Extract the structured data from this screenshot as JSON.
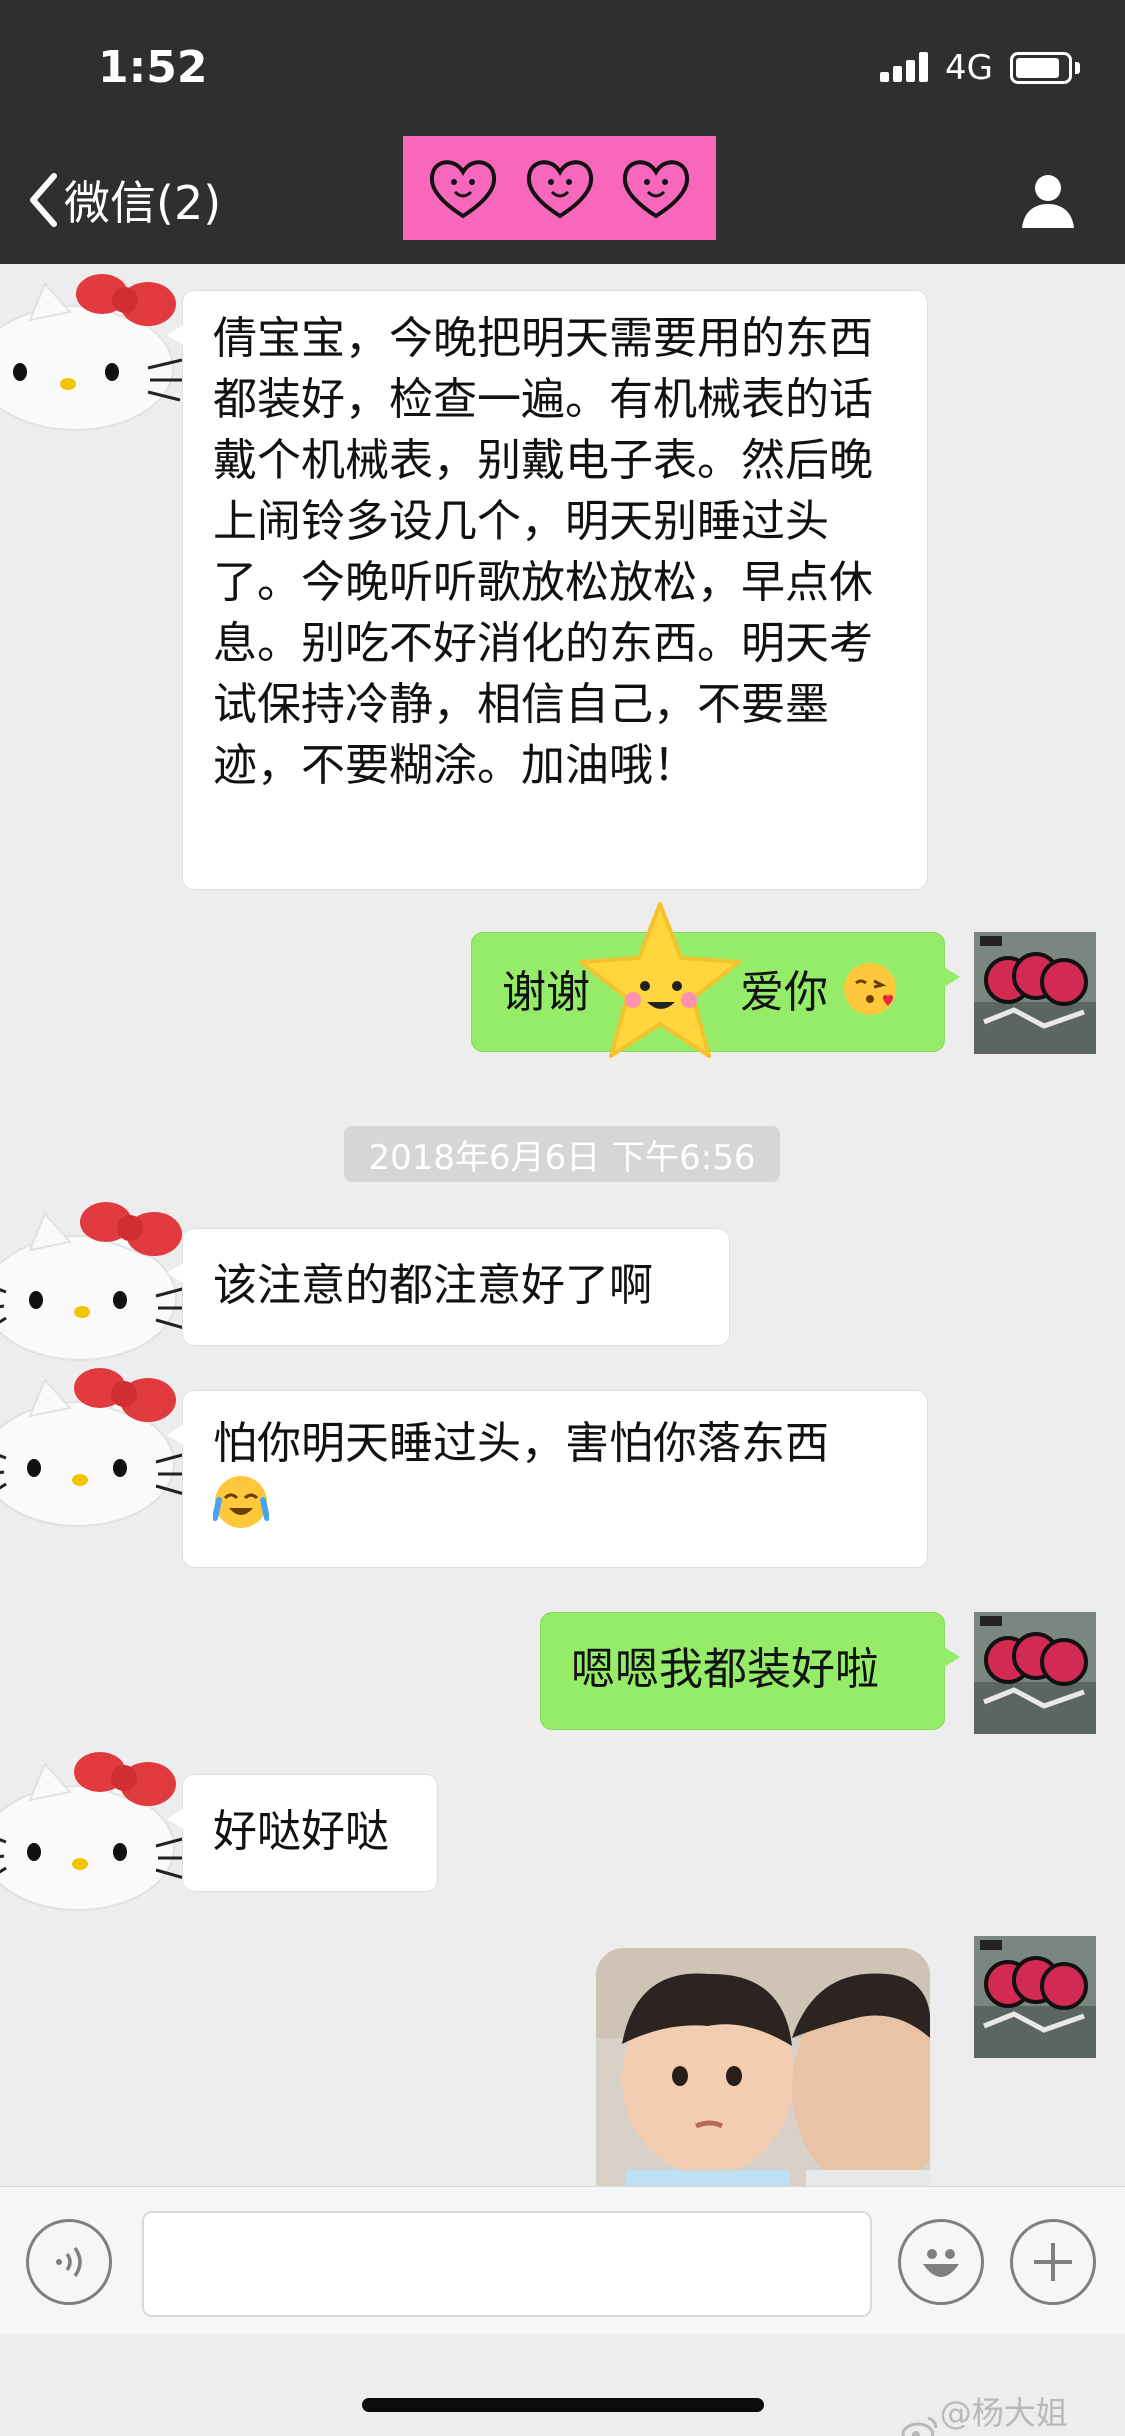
{
  "status_bar": {
    "time": "1:52",
    "network": "4G",
    "battery_level": 0.85
  },
  "nav": {
    "back_label": "微信(2)"
  },
  "messages": [
    {
      "side": "in",
      "text": "倩宝宝，今晚把明天需要用的东西都装好，检查一遍。有机械表的话戴个机械表，别戴电子表。然后晚上闹铃多设几个，明天别睡过头了。今晚听听歌放松放松，早点休息。别吃不好消化的东西。明天考试保持冷静，相信自己，不要墨迹，不要糊涂。加油哦！"
    },
    {
      "side": "out",
      "text_before": "谢谢",
      "text_after": "爱你",
      "emoji": "kissing-heart-emoji",
      "sticker": "smiling-star-sticker"
    },
    {
      "side": "in",
      "text": "该注意的都注意好了啊"
    },
    {
      "side": "in",
      "text": "怕你明天睡过头，害怕你落东西",
      "emoji": "loudly-crying-emoji"
    },
    {
      "side": "out",
      "text": "嗯嗯我都装好啦"
    },
    {
      "side": "in",
      "text": "好哒好哒"
    },
    {
      "side": "out",
      "type": "image",
      "description_icon": "photo-children"
    }
  ],
  "timestamp": "2018年6月6日 下午6:56",
  "watermark": "@杨大姐YYY",
  "colors": {
    "nav_background": "#2f2f31",
    "chat_background": "#ededed",
    "outgoing_bubble": "#95ec69",
    "incoming_bubble": "#ffffff",
    "title_sticker": "#f768bd"
  },
  "icons": {
    "back": "chevron-left-icon",
    "profile": "person-icon",
    "voice": "voice-icon",
    "emoji": "smiley-face-icon",
    "more": "plus-icon",
    "incoming_avatar": "hello-kitty-avatar",
    "outgoing_avatar": "graffiti-avatar"
  }
}
